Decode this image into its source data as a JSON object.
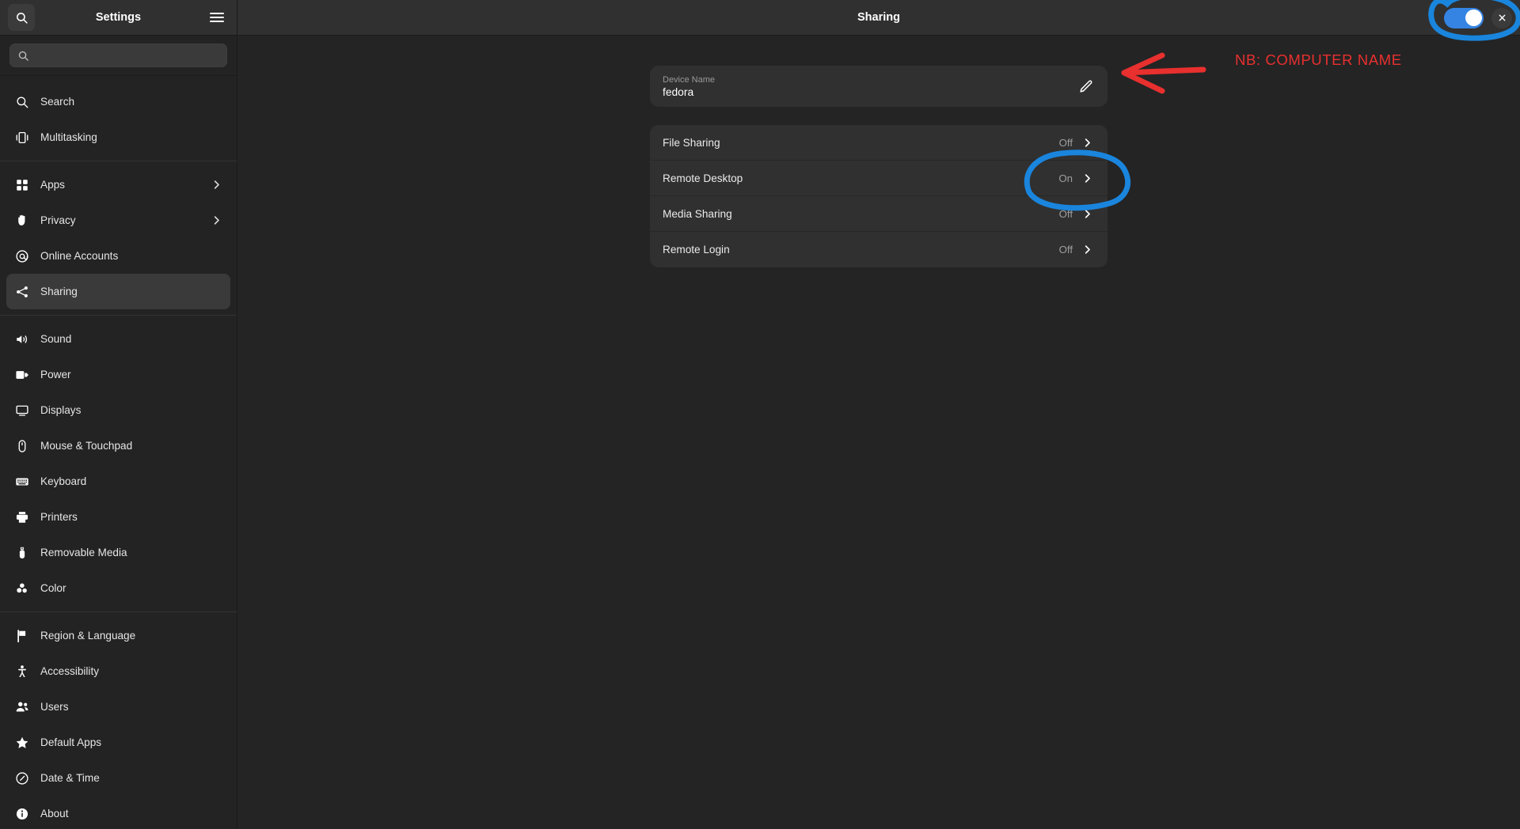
{
  "window": {
    "sidebar_title": "Settings",
    "main_title": "Sharing",
    "search_icon": "search-icon",
    "menu_icon": "hamburger-menu-icon",
    "close_icon": "close-icon",
    "toggle_state": "on",
    "accent_color": "#3584e4"
  },
  "search": {
    "value": "",
    "placeholder": "",
    "icon": "search-icon"
  },
  "sidebar": {
    "groups": [
      {
        "items": [
          {
            "label": "Search",
            "icon": "search-icon",
            "chevron": false,
            "selected": false
          },
          {
            "label": "Multitasking",
            "icon": "multitasking-icon",
            "chevron": false,
            "selected": false
          }
        ]
      },
      {
        "items": [
          {
            "label": "Apps",
            "icon": "apps-grid-icon",
            "chevron": true,
            "selected": false
          },
          {
            "label": "Privacy",
            "icon": "hand-privacy-icon",
            "chevron": true,
            "selected": false
          },
          {
            "label": "Online Accounts",
            "icon": "at-sign-icon",
            "chevron": false,
            "selected": false
          },
          {
            "label": "Sharing",
            "icon": "share-nodes-icon",
            "chevron": false,
            "selected": true
          }
        ]
      },
      {
        "items": [
          {
            "label": "Sound",
            "icon": "speaker-icon",
            "chevron": false,
            "selected": false
          },
          {
            "label": "Power",
            "icon": "battery-power-icon",
            "chevron": false,
            "selected": false
          },
          {
            "label": "Displays",
            "icon": "monitor-icon",
            "chevron": false,
            "selected": false
          },
          {
            "label": "Mouse & Touchpad",
            "icon": "mouse-icon",
            "chevron": false,
            "selected": false
          },
          {
            "label": "Keyboard",
            "icon": "keyboard-icon",
            "chevron": false,
            "selected": false
          },
          {
            "label": "Printers",
            "icon": "printer-icon",
            "chevron": false,
            "selected": false
          },
          {
            "label": "Removable Media",
            "icon": "usb-drive-icon",
            "chevron": false,
            "selected": false
          },
          {
            "label": "Color",
            "icon": "color-circles-icon",
            "chevron": false,
            "selected": false
          }
        ]
      },
      {
        "items": [
          {
            "label": "Region & Language",
            "icon": "flag-icon",
            "chevron": false,
            "selected": false
          },
          {
            "label": "Accessibility",
            "icon": "accessibility-person-icon",
            "chevron": false,
            "selected": false
          },
          {
            "label": "Users",
            "icon": "users-icon",
            "chevron": false,
            "selected": false
          },
          {
            "label": "Default Apps",
            "icon": "star-icon",
            "chevron": false,
            "selected": false
          },
          {
            "label": "Date & Time",
            "icon": "clock-icon",
            "chevron": false,
            "selected": false
          },
          {
            "label": "About",
            "icon": "info-circle-icon",
            "chevron": false,
            "selected": false
          }
        ]
      }
    ]
  },
  "main": {
    "device_name": {
      "label": "Device Name",
      "value": "fedora",
      "edit_icon": "pencil-edit-icon"
    },
    "sharing_rows": [
      {
        "label": "File Sharing",
        "status": "Off",
        "chevron": "chevron-right-icon"
      },
      {
        "label": "Remote Desktop",
        "status": "On",
        "chevron": "chevron-right-icon"
      },
      {
        "label": "Media Sharing",
        "status": "Off",
        "chevron": "chevron-right-icon"
      },
      {
        "label": "Remote Login",
        "status": "Off",
        "chevron": "chevron-right-icon"
      }
    ]
  },
  "annotations": {
    "note_text": "NB: COMPUTER NAME",
    "note_color": "#e8302f",
    "highlight_color": "#1a85dd",
    "arrow": "red-arrow-pointing-left",
    "circles": [
      "blue-circle-around-remote-desktop-status",
      "blue-circle-around-window-toggle-and-close"
    ]
  }
}
